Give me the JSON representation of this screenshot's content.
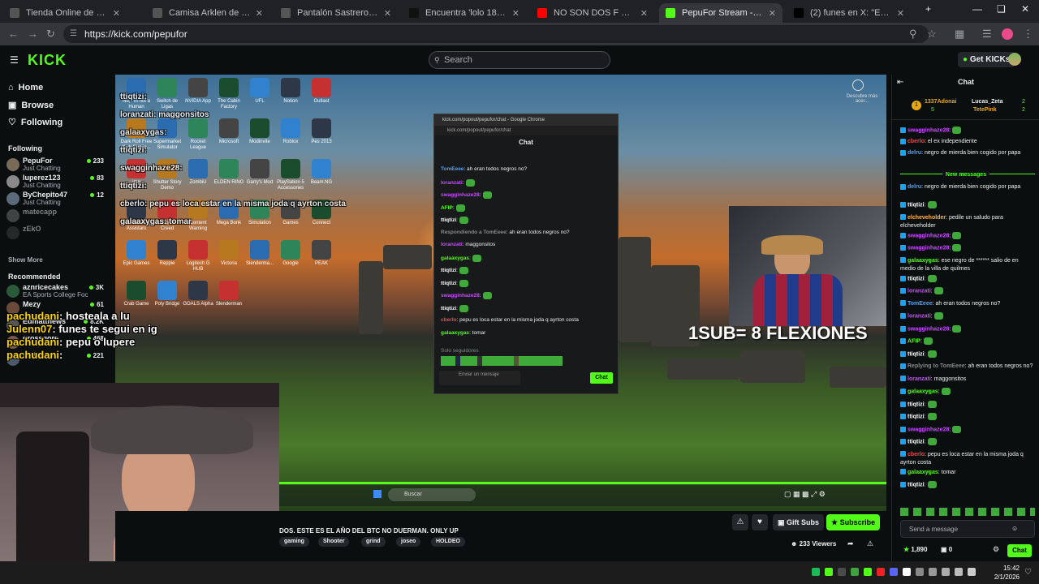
{
  "browser": {
    "tabs": [
      {
        "label": "Tienda Online de HHUST",
        "color": "#555555"
      },
      {
        "label": "Camisa Arklen de lino con esta",
        "color": "#555555"
      },
      {
        "label": "Pantalón Sastrero Brenor Raya",
        "color": "#555555"
      },
      {
        "label": "Encuentra 'lolo 18 años' en Tik",
        "color": "#111111"
      },
      {
        "label": "NO SON DOS F SON CLONES",
        "color": "#ff0000"
      },
      {
        "label": "PepuFor Stream - Watch Li",
        "color": "#53fc18"
      },
      {
        "label": "(2) funes en X: \"ESTE ES EL VER",
        "color": "#000000"
      }
    ],
    "url": "https://kick.com/pepufor",
    "new_tab": "+"
  },
  "header": {
    "logo": "KICK",
    "search_placeholder": "Search",
    "get_kicks": "Get KICKs"
  },
  "sidebar": {
    "nav": [
      {
        "label": "Home",
        "icon": "home-icon"
      },
      {
        "label": "Browse",
        "icon": "browse-icon"
      },
      {
        "label": "Following",
        "icon": "heart-icon"
      }
    ],
    "following_title": "Following",
    "following": [
      {
        "name": "PepuFor",
        "category": "Just Chatting",
        "viewers": "233",
        "color": "#7a6a5a"
      },
      {
        "name": "luperez123",
        "category": "Just Chatting",
        "viewers": "83",
        "color": "#8a8a8a"
      },
      {
        "name": "ByChepito47",
        "category": "Just Chatting",
        "viewers": "12",
        "color": "#5a6a7a"
      },
      {
        "name": "matecapp",
        "category": "",
        "viewers": "",
        "color": "#777777"
      },
      {
        "name": "zEkO",
        "category": "",
        "viewers": "",
        "color": "#444444"
      }
    ],
    "show_more": "Show More",
    "recommended_title": "Recommended",
    "recommended": [
      {
        "name": "aznricecakes",
        "category": "EA Sports College Foot...",
        "viewers": "3K",
        "color": "#2a5a3a"
      },
      {
        "name": "Mezy",
        "category": "",
        "viewers": "61",
        "color": "#6a4a3a"
      },
      {
        "name": "Edmatthews",
        "category": "",
        "viewers": "8.2K",
        "color": "#555555"
      },
      {
        "name": "grossgore",
        "category": "",
        "viewers": "468",
        "color": "#7a5a4a"
      },
      {
        "name": "IrishGT",
        "category": "",
        "viewers": "221",
        "color": "#4a5a6a"
      }
    ]
  },
  "stream": {
    "overlay_chat": [
      {
        "user": "pachudani",
        "msg": ": hosteala a lu"
      },
      {
        "user": "Julenn07",
        "msg": ": funes te segui en ig"
      },
      {
        "user": "pachudani",
        "msg": ": pepu o lupere"
      },
      {
        "user": "pachudani",
        "msg": ":"
      }
    ],
    "desktop_overlay": [
      {
        "user": "ttiqtizi",
        "msg": ":"
      },
      {
        "user": "loranzati",
        "msg": ": maggonsitos"
      },
      {
        "user": "galaaxygas",
        "msg": ":"
      },
      {
        "user": "ttiqtizi",
        "msg": ":"
      },
      {
        "user": "swagginhaze28",
        "msg": ":"
      },
      {
        "user": "ttiqtizi",
        "msg": ":"
      },
      {
        "user": "cberlo",
        "msg": ": pepu es loca estar en la misma joda q ayrton costa"
      },
      {
        "user": "galaaxygas",
        "msg": ": tomar"
      }
    ],
    "desktop_icons": [
      "Nu, I'm not a Human",
      "Switch de Ligas",
      "NVIDIA App",
      "The Cabin Factory",
      "UFL",
      "Notion",
      "Outlast",
      "Dark Roll Free Kick Challe...",
      "Supermarket Simulator",
      "Rocket League",
      "Microsoft",
      "Modinvite",
      "Roblox",
      "Pes 2013",
      "img",
      "Shutter Story Demo",
      "ZombiU",
      "ELDEN RING",
      "Garry's Mod",
      "PlaySation 5 Accessories",
      "Beam.NG",
      "The Mortuary Assistant",
      "Assassin's Creed",
      "Content Warning",
      "Mega Bonk",
      "Simulation",
      "Games",
      "Connect",
      "Epic Games",
      "Reppie",
      "Logitech G HUB",
      "Victoria",
      "Slenderma...",
      "Google",
      "PEAK",
      "Crab Game",
      "Poly Bridge",
      "GOALS Alpha",
      "Slenderman"
    ],
    "popup": {
      "window_title": "kick.com/popout/pepufor/chat - Google Chrome",
      "url": "kick.com/popout/pepufor/chat",
      "header": "Chat",
      "messages": [
        {
          "user": "TomEeee",
          "msg": ": ah eran todos negros no?",
          "color": "#4ea1ff"
        },
        {
          "user": "loranzati",
          "msg": ":",
          "color": "#c94cff"
        },
        {
          "user": "swagginhaze28",
          "msg": ":",
          "color": "#c94cff"
        },
        {
          "user": "AFIP",
          "msg": ":",
          "color": "#53fc18"
        },
        {
          "user": "ttiqtizi",
          "msg": ":",
          "color": "#ffffff"
        },
        {
          "user": "Respondiendo a TomEeee",
          "msg": ": ah eran todos negros no?",
          "color": "#888888"
        },
        {
          "user": "loranzati",
          "msg": ": maggonsitos",
          "color": "#c94cff"
        },
        {
          "user": "galaaxygas",
          "msg": ":",
          "color": "#53fc18"
        },
        {
          "user": "ttiqtizi",
          "msg": ":",
          "color": "#ffffff"
        },
        {
          "user": "ttiqtizi",
          "msg": ":",
          "color": "#ffffff"
        },
        {
          "user": "swagginhaze28",
          "msg": ":",
          "color": "#c94cff"
        },
        {
          "user": "ttiqtizi",
          "msg": ":",
          "color": "#ffffff"
        },
        {
          "user": "cberlo",
          "msg": ": pepu es loca estar en la misma joda q ayrton costa",
          "color": "#ff4444"
        },
        {
          "user": "galaaxygas",
          "msg": ": tomar",
          "color": "#53fc18"
        }
      ],
      "followers_only": "Solo seguidores",
      "input_placeholder": "Enviar un mensaje",
      "chat_button": "Chat"
    },
    "cam_text": "1SUB= 8 FLEXIONES",
    "taskbar_search": "Buscar",
    "corner_label": "Descubre más acer..."
  },
  "info": {
    "title": "DOS. ESTE ES EL AÑO DEL BTC NO DUERMAN. ONLY UP",
    "tags": [
      "gaming",
      "Shooter",
      "grind",
      "joseo",
      "HOLDEO"
    ],
    "gift_subs": "Gift Subs",
    "subscribe": "Subscribe",
    "viewers": "233 Viewers"
  },
  "chat": {
    "title": "Chat",
    "top_gifters": [
      {
        "rank": "1",
        "name": "1337Adonai",
        "count": "5"
      },
      {
        "rank": "",
        "name": "Lucas_Zeta",
        "count": "2"
      },
      {
        "rank": "",
        "name": "TetePink",
        "count": "2"
      }
    ],
    "messages_before": [
      {
        "user": "swagginhaze28",
        "msg": ":",
        "color": "#c94cff"
      },
      {
        "user": "cberlo",
        "msg": ": el ex independiente",
        "color": "#ff4444"
      },
      {
        "user": "delru",
        "msg": ": negro de mierda bien cogido por papa",
        "color": "#4ea1ff"
      }
    ],
    "new_messages": "New messages",
    "messages_after": [
      {
        "user": "delru",
        "msg": ": negro de mierda bien cogido por papa",
        "color": "#4ea1ff"
      },
      {
        "user": "ttiqtizi",
        "msg": ":",
        "color": "#ffffff"
      },
      {
        "user": "elcheveholder",
        "msg": ": pedile un saludo para elcheveholder",
        "color": "#ffb347"
      },
      {
        "user": "swagginhaze28",
        "msg": ":",
        "color": "#c94cff"
      },
      {
        "user": "swagginhaze28",
        "msg": ":",
        "color": "#c94cff"
      },
      {
        "user": "galaaxygas",
        "msg": ": ese negro de ****** salio de en medio de la villa de quilmes",
        "color": "#53fc18"
      },
      {
        "user": "ttiqtizi",
        "msg": ":",
        "color": "#ffffff"
      },
      {
        "user": "loranzati",
        "msg": ":",
        "color": "#c94cff"
      },
      {
        "user": "TomEeee",
        "msg": ": ah eran todos negros no?",
        "color": "#4ea1ff"
      },
      {
        "user": "loranzati",
        "msg": ":",
        "color": "#c94cff"
      },
      {
        "user": "swagginhaze28",
        "msg": ":",
        "color": "#c94cff"
      },
      {
        "user": "AFIP",
        "msg": ":",
        "color": "#53fc18"
      },
      {
        "user": "ttiqtizi",
        "msg": ":",
        "color": "#ffffff"
      },
      {
        "user": "Replying to TomEeee",
        "msg": ": ah eran todos negros no?",
        "color": "#888888"
      },
      {
        "user": "loranzati",
        "msg": ": maggonsitos",
        "color": "#c94cff"
      },
      {
        "user": "galaaxygas",
        "msg": ":",
        "color": "#53fc18"
      },
      {
        "user": "ttiqtizi",
        "msg": ":",
        "color": "#ffffff"
      },
      {
        "user": "ttiqtizi",
        "msg": ":",
        "color": "#ffffff"
      },
      {
        "user": "swagginhaze28",
        "msg": ":",
        "color": "#c94cff"
      },
      {
        "user": "ttiqtizi",
        "msg": ":",
        "color": "#ffffff"
      },
      {
        "user": "cberlo",
        "msg": ": pepu es loca estar en la misma joda q ayrton costa",
        "color": "#ff4444"
      },
      {
        "user": "galaaxygas",
        "msg": ": tomar",
        "color": "#53fc18"
      },
      {
        "user": "ttiqtizi",
        "msg": ":",
        "color": "#ffffff"
      }
    ],
    "input_placeholder": "Send a message",
    "points": "1,890",
    "zero": "0",
    "chat_button": "Chat"
  },
  "taskbar": {
    "time": "15:42",
    "date": "2/1/2026"
  }
}
